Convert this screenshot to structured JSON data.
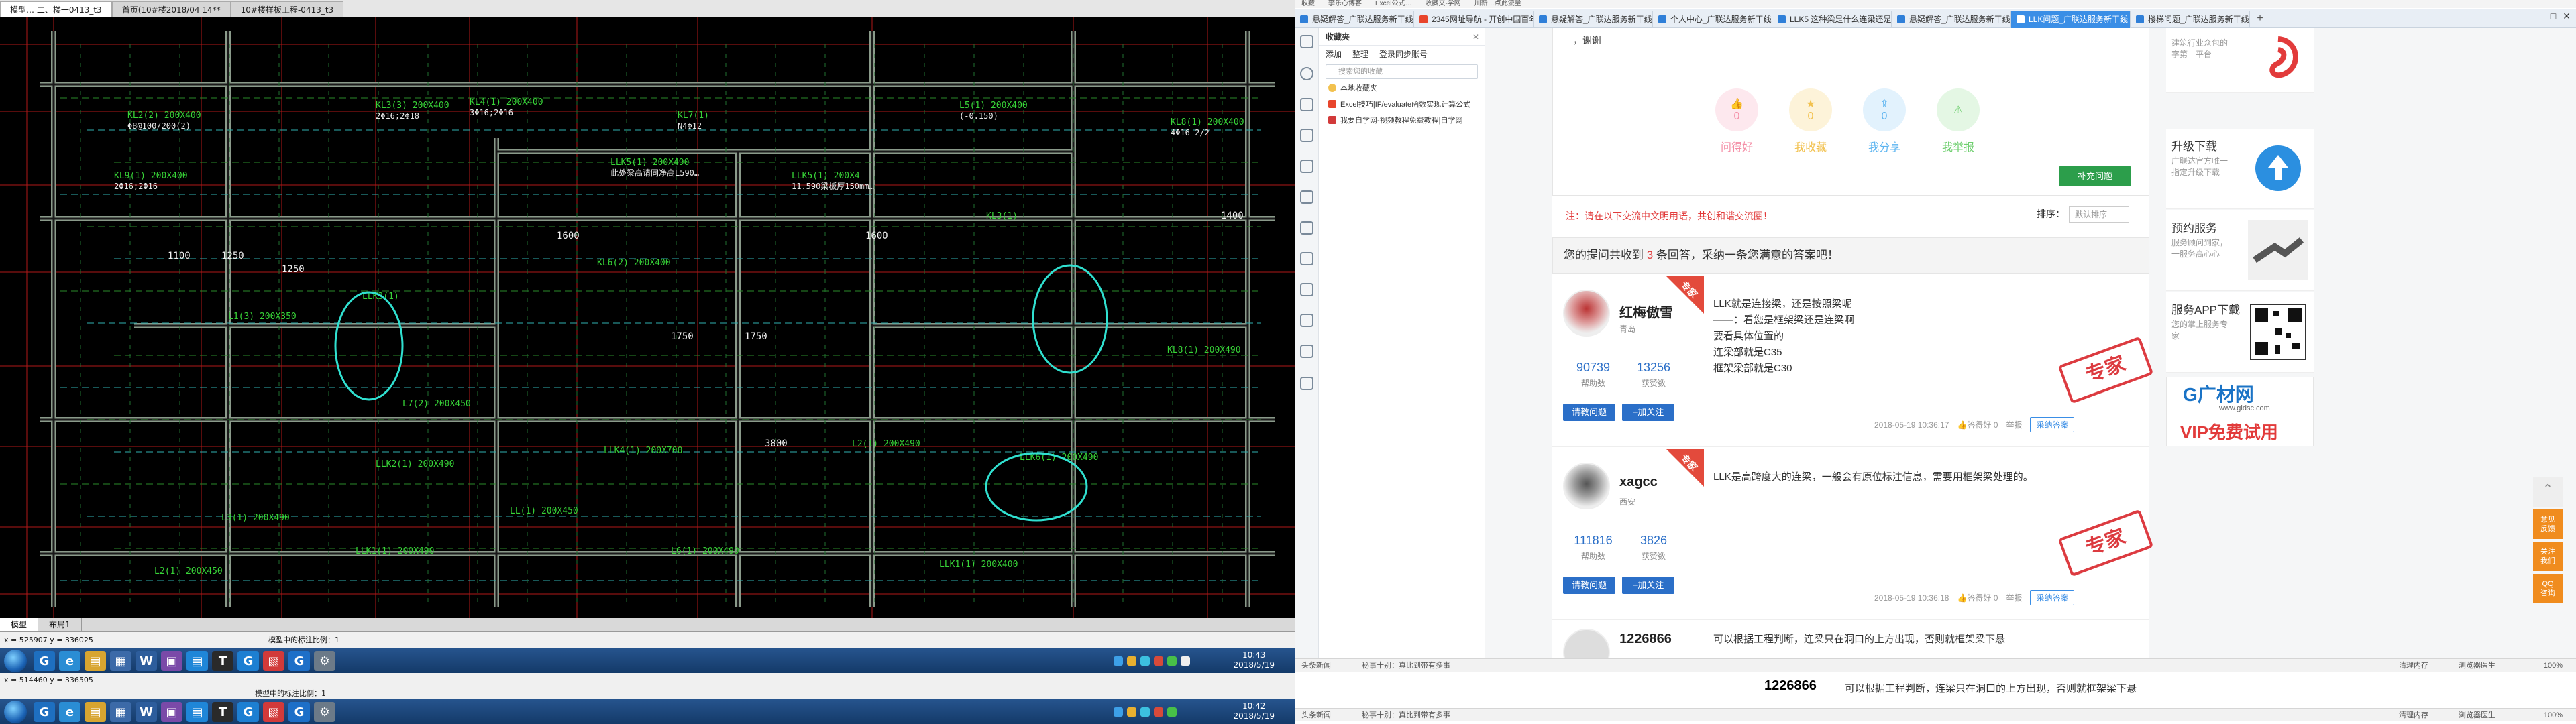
{
  "cad": {
    "tabs": [
      "模型…  二、楼一0413_t3",
      "首页(10#楼2018/04 14**",
      "10#楼样板工程-0413_t3"
    ],
    "layout_tabs": [
      "模型",
      "布局1"
    ],
    "coords_top": "x = 525907  y = 336025",
    "coords_bottom": "x = 514460  y = 336505",
    "cmd_text": "模型中的标注比例：1",
    "beams": [
      "KL2(2) 200X400",
      "KL3(3) 200X400",
      "KL4(1) 200X400",
      "KL7(1)",
      "L5(1) 200X400",
      "KL8(1) 200X400",
      "KL9(1) 200X400",
      "LLK5(1) 200X490",
      "LLK5(1) 200X4",
      "KL6(2) 200X400",
      "L7(2) 200X450",
      "L1(3) 200X350",
      "KL3(1)",
      "LLK3(1)",
      "LLK6(1) 200X490",
      "LLK4(1) 200X700",
      "LLK2(1) 200X490",
      "L3(1) 200X490",
      "L2(1) 200X450",
      "L6(1) 200X490",
      "LLK1(1) 200X490",
      "KL8(1) 200X490",
      "L2(1) 200X490",
      "LLK1(1) 200X400",
      "LL(1) 200X450"
    ],
    "dims": [
      "1100",
      "1250",
      "1250",
      "1600",
      "1600",
      "1750",
      "1750",
      "3800",
      "1400"
    ],
    "notes": [
      "Φ8@100/200(2)",
      "2Φ16;2Φ18",
      "3Φ16;2Φ16",
      "N4Φ12",
      "(-0.150)",
      "4Φ16 2/2",
      "2Φ16;2Φ16",
      "此处梁高请同净高L590…",
      "11.590梁板厚150mm…"
    ]
  },
  "taskbar": {
    "top_time": "10:43",
    "top_date": "2018/5/19",
    "bottom_time": "10:42",
    "bottom_date": "2018/5/19",
    "status": "模型中的标注比例：1"
  },
  "browser": {
    "top_links": [
      "收藏",
      "李乐心博客",
      "Excel公式…",
      "收藏夹-学网",
      "川新…点此流量"
    ],
    "tabs": [
      "悬疑解答_广联达服务新干线",
      "2345网址导航 - 开创中国百年…",
      "悬疑解答_广联达服务新干线",
      "个人中心_广联达服务新干线",
      "LLK5 这种梁是什么连梁还是…",
      "悬疑解答_广联达服务新干线",
      "LLK问题_广联达服务新干线",
      "楼梯问题_广联达服务新干线"
    ],
    "active_tab": 6,
    "favorites": {
      "title": "收藏夹",
      "tools": [
        "添加",
        "整理",
        "登录同步账号"
      ],
      "search_placeholder": "搜索您的收藏",
      "items": [
        "本地收藏夹",
        "Excel技巧|IF/evaluate函数实现计算公式",
        "我要自学网-视频教程免费教程|自学网"
      ]
    },
    "status_bar": {
      "left": "头条新闻",
      "news": "秘事十别：真比到带有多事",
      "right": [
        "清理内存",
        "浏览器医生",
        "100%"
      ]
    }
  },
  "qa": {
    "thanks": "，谢谢",
    "reactions": [
      {
        "label": "问得好",
        "count": "0",
        "color": "#f48ea6"
      },
      {
        "label": "我收藏",
        "count": "0",
        "color": "#f2c14e"
      },
      {
        "label": "我分享",
        "count": "0",
        "color": "#5cb4f0"
      },
      {
        "label": "我举报",
        "count": "",
        "color": "#6fcf6f"
      }
    ],
    "reply_button": "补充问题",
    "notice": "注：请在以下交流中文明用语，共创和谐交流圈！",
    "sort_label": "排序：",
    "sort_value": "默认排序",
    "answers_header_pre": "您的提问共收到 ",
    "answers_count": "3",
    "answers_header_post": " 条回答，采纳一条您满意的答案吧！",
    "answers": [
      {
        "name": "红梅傲雪",
        "loc": "青岛",
        "ribbon": "专家",
        "helped": "90739",
        "helped_label": "帮助数",
        "likes": "13256",
        "likes_label": "获赞数",
        "btn1": "请教问题",
        "btn2": "+加关注",
        "text": [
          "LLK就是连接梁，还是按照梁呢",
          "——：看您是框架梁还是连梁啊",
          "要看具体位置的",
          "连梁部就是C35",
          "框架梁部就是C30"
        ],
        "stamp": "专家",
        "time": "2018-05-19 10:36:17",
        "good": "答得好",
        "good_count": "0",
        "report": "举报",
        "adopt": "采纳答案"
      },
      {
        "name": "xagcc",
        "loc": "西安",
        "ribbon": "专家",
        "helped": "111816",
        "helped_label": "帮助数",
        "likes": "3826",
        "likes_label": "获赞数",
        "btn1": "请教问题",
        "btn2": "+加关注",
        "text": [
          "LLK是高跨度大的连梁，一般会有原位标注信息，需要用框架梁处理的。"
        ],
        "stamp": "专家",
        "time": "2018-05-19 10:36:18",
        "good": "答得好",
        "good_count": "0",
        "report": "举报",
        "adopt": "采纳答案"
      },
      {
        "name": "1226866",
        "text": [
          "可以根据工程判断，连梁只在洞口的上方出现，否则就框架梁下悬"
        ]
      }
    ],
    "sidebar": [
      {
        "title": "",
        "desc": "建筑行业众包的\n字第一平台"
      },
      {
        "title": "升级下载",
        "desc": "广联达官方唯一\n指定升级下载"
      },
      {
        "title": "预约服务",
        "desc": "服务顾问到家，\n一服务高心心"
      },
      {
        "title": "服务APP下载",
        "desc": "您的掌上服务专\n家"
      }
    ],
    "ad": {
      "logo": "G广材网",
      "url": "www.gldsc.com",
      "slogan": "VIP免费试用"
    },
    "float": [
      "意见\n反馈",
      "关注\n我们",
      "QQ\n咨询"
    ]
  }
}
